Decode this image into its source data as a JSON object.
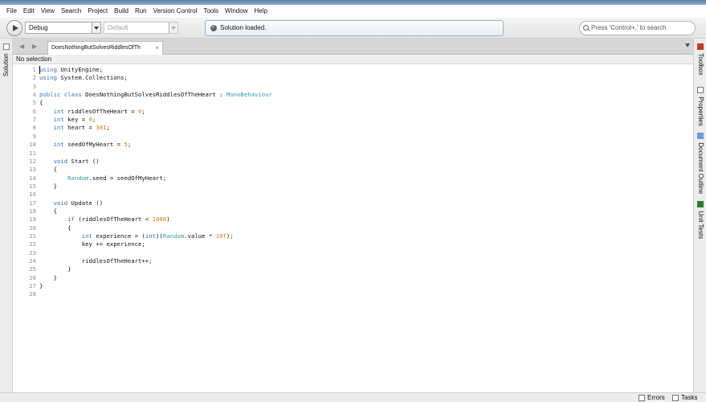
{
  "menu": [
    "File",
    "Edit",
    "View",
    "Search",
    "Project",
    "Build",
    "Run",
    "Version Control",
    "Tools",
    "Window",
    "Help"
  ],
  "toolbar": {
    "config": "Debug",
    "platform": "Default",
    "status": "Solution loaded.",
    "search_placeholder": "Press 'Control+,' to search"
  },
  "left_pad": {
    "solution": "Solution"
  },
  "right_pads": [
    "Toolbox",
    "Properties",
    "Document Outline",
    "Unit Tests"
  ],
  "tab": {
    "label": "DoesNothingButSolvesRiddlesOfTh"
  },
  "selection": "No selection",
  "code_lines": [
    "using UnityEngine;",
    "using System.Collections;",
    "",
    "public class DoesNothingButSolvesRiddlesOfTheHeart : MonoBehaviour",
    "{",
    "    int riddlesOfTheHeart = 0;",
    "    int key = 0;",
    "    int heart = 381;",
    "",
    "    int seedOfMyHeart = 5;",
    "",
    "    void Start ()",
    "    {",
    "        Random.seed = seedOfMyHeart;",
    "    }",
    "",
    "    void Update ()",
    "    {",
    "        if (riddlesOfTheHeart < 1000)",
    "        {",
    "            int experience = (int)(Random.value * 10f);",
    "            key += experience;",
    "",
    "            riddlesOfTheHeart++;",
    "        }",
    "    }",
    "}",
    ""
  ],
  "statusbar": {
    "errors": "Errors",
    "tasks": "Tasks"
  }
}
